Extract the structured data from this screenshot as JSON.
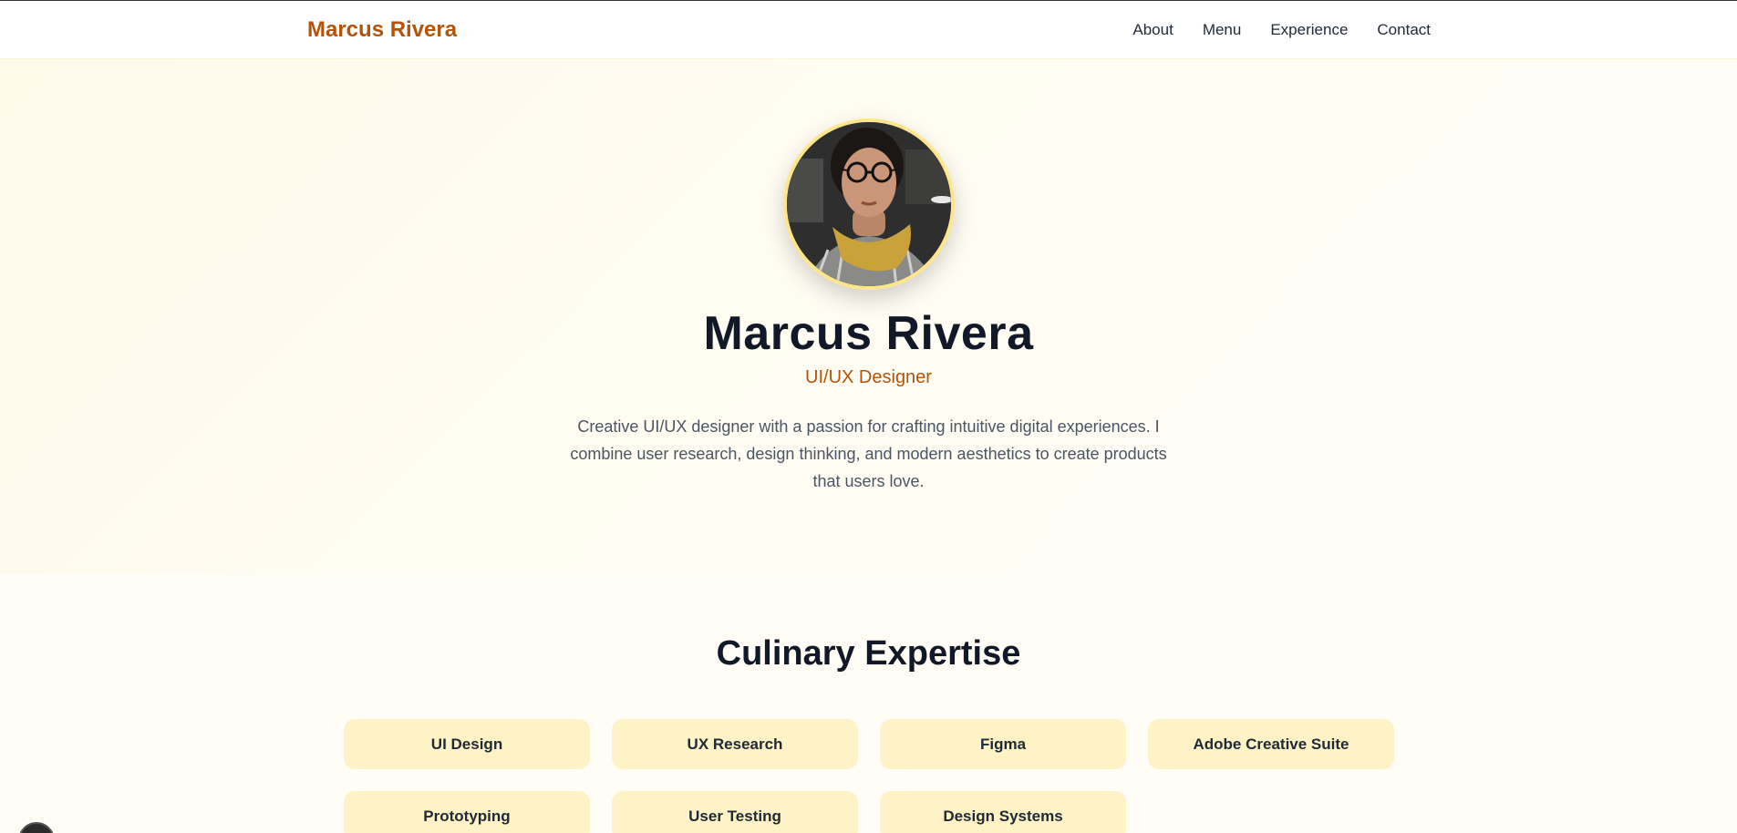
{
  "header": {
    "brand": "Marcus Rivera",
    "nav": [
      "About",
      "Menu",
      "Experience",
      "Contact"
    ]
  },
  "hero": {
    "name": "Marcus Rivera",
    "role": "UI/UX Designer",
    "bio": "Creative UI/UX designer with a passion for crafting intuitive digital experiences. I combine user research, design thinking, and modern aesthetics to create products that users love.",
    "avatar_icon": "profile-photo"
  },
  "expertise": {
    "title": "Culinary Expertise",
    "skills": [
      "UI Design",
      "UX Research",
      "Figma",
      "Adobe Creative Suite",
      "Prototyping",
      "User Testing",
      "Design Systems"
    ]
  },
  "colors": {
    "accent": "#b45309",
    "chip_bg": "#fef3c7",
    "avatar_ring": "#fde68a"
  }
}
